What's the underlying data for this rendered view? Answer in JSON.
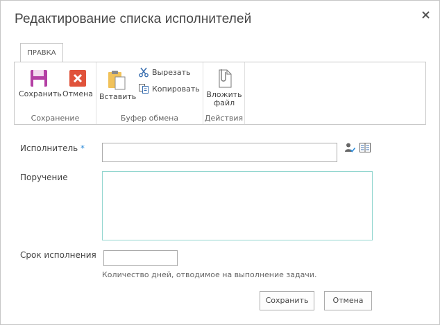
{
  "dialog": {
    "title": "Редактирование списка исполнителей"
  },
  "ribbon": {
    "tab": "ПРАВКА",
    "groups": {
      "save": {
        "label": "Сохранение",
        "save_button": "Сохранить",
        "cancel_button": "Отмена"
      },
      "clipboard": {
        "label": "Буфер обмена",
        "paste_button": "Вставить",
        "cut_button": "Вырезать",
        "copy_button": "Копировать"
      },
      "actions": {
        "label": "Действия",
        "attach_line1": "Вложить",
        "attach_line2": "файл"
      }
    }
  },
  "form": {
    "executor": {
      "label": "Исполнитель",
      "required_mark": "*",
      "value": ""
    },
    "assignment": {
      "label": "Поручение",
      "value": ""
    },
    "deadline": {
      "label": "Срок исполнения",
      "value": "",
      "hint": "Количество дней, отводимое на выполнение задачи."
    }
  },
  "footer": {
    "save": "Сохранить",
    "cancel": "Отмена"
  },
  "colors": {
    "save_icon": "#b43fa4",
    "cancel_icon": "#e0533b",
    "accent": "#2b8ad8"
  }
}
